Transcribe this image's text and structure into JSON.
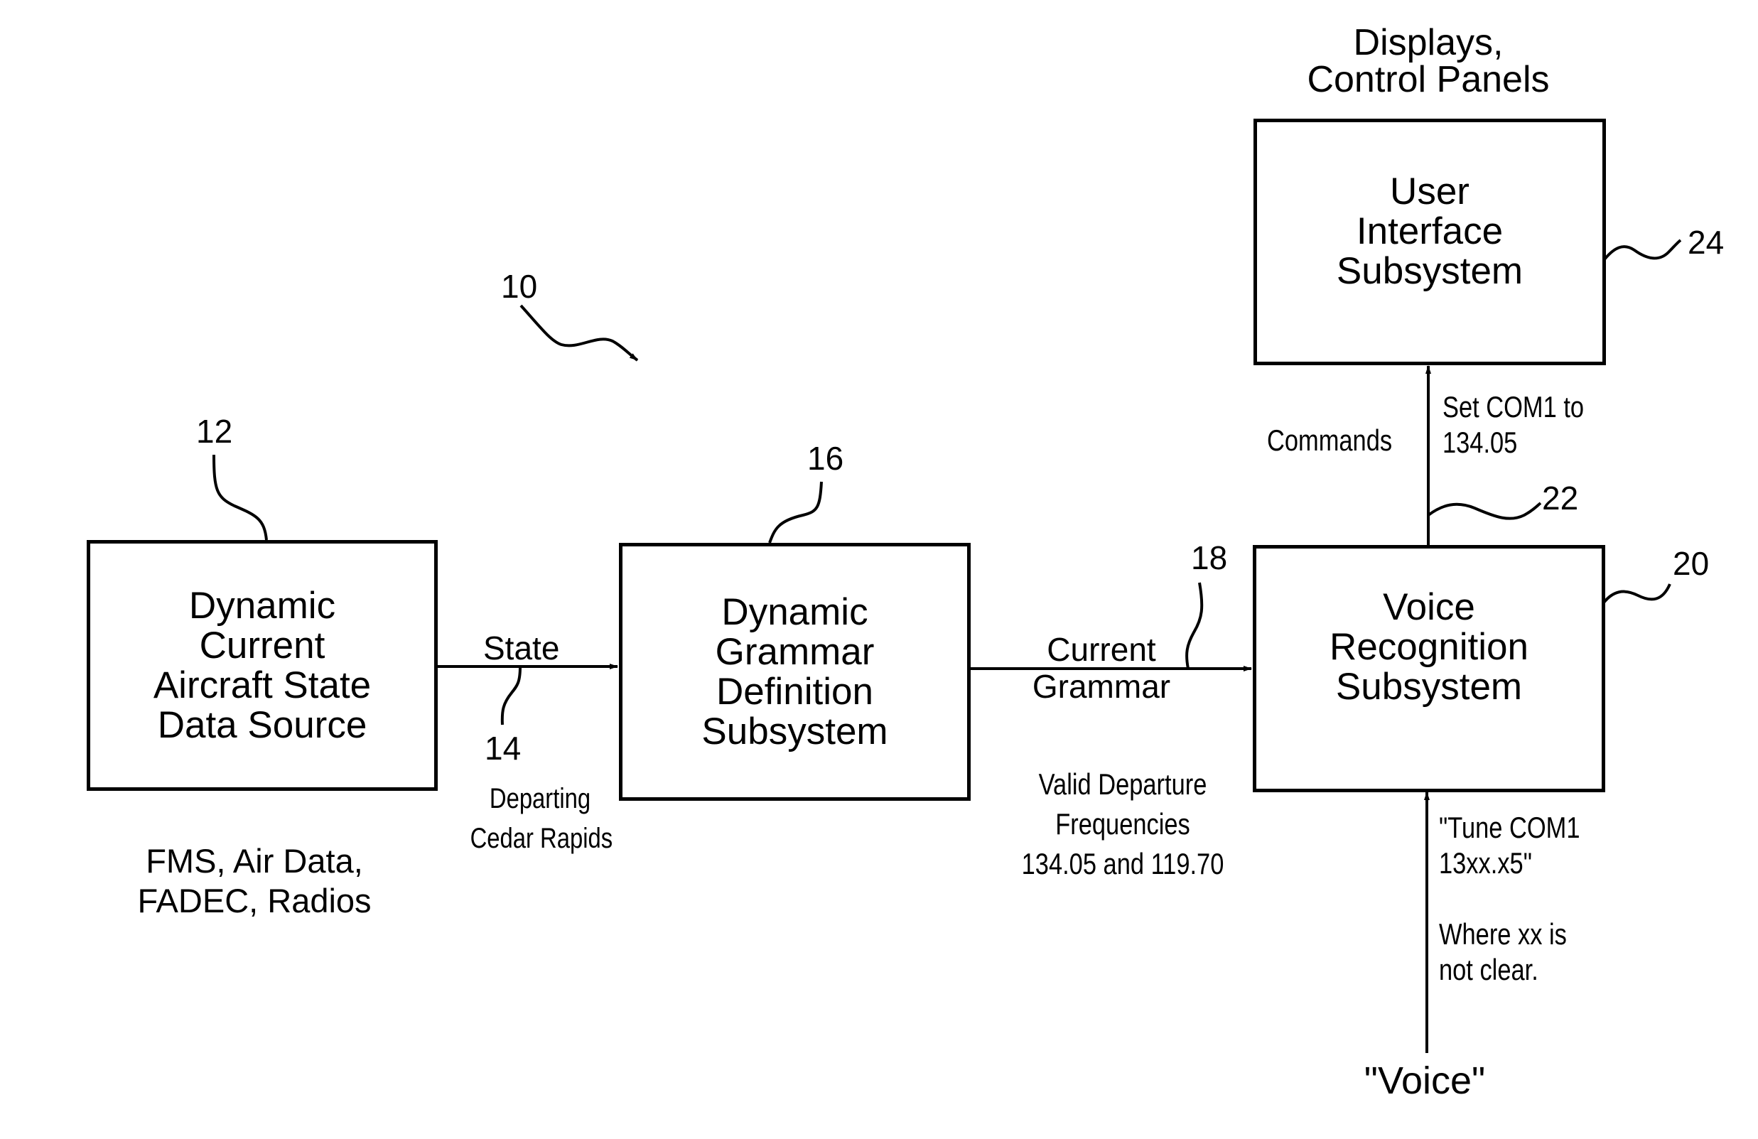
{
  "figure": {
    "system_ref": "10",
    "blocks": [
      {
        "id": "data-source",
        "ref": "12",
        "lines": [
          "Dynamic",
          "Current",
          "Aircraft State",
          "Data Source"
        ]
      },
      {
        "id": "grammar-definition",
        "ref": "16",
        "lines": [
          "Dynamic",
          "Grammar",
          "Definition",
          "Subsystem"
        ]
      },
      {
        "id": "voice-recognition",
        "ref": "20",
        "lines": [
          "Voice",
          "Recognition",
          "Subsystem"
        ]
      },
      {
        "id": "user-interface",
        "ref": "24",
        "lines": [
          "User",
          "Interface",
          "Subsystem"
        ]
      }
    ],
    "source_note": [
      "FMS, Air Data,",
      "FADEC, Radios"
    ],
    "ui_note": [
      "Displays,",
      "Control Panels"
    ],
    "state_link": {
      "ref": "14",
      "label": "State",
      "example": [
        "Departing",
        "Cedar Rapids"
      ]
    },
    "grammar_link": {
      "ref": "18",
      "label": [
        "Current",
        "Grammar"
      ],
      "example": [
        "Valid Departure",
        "Frequencies",
        "134.05 and 119.70"
      ]
    },
    "commands_link": {
      "ref": "22",
      "label": "Commands",
      "example": [
        "Set COM1 to",
        "134.05"
      ]
    },
    "voice_input": {
      "label": "\"Voice\"",
      "example": [
        "\"Tune COM1",
        "13xx.x5\""
      ],
      "note": [
        "Where xx is",
        "not clear."
      ]
    }
  }
}
